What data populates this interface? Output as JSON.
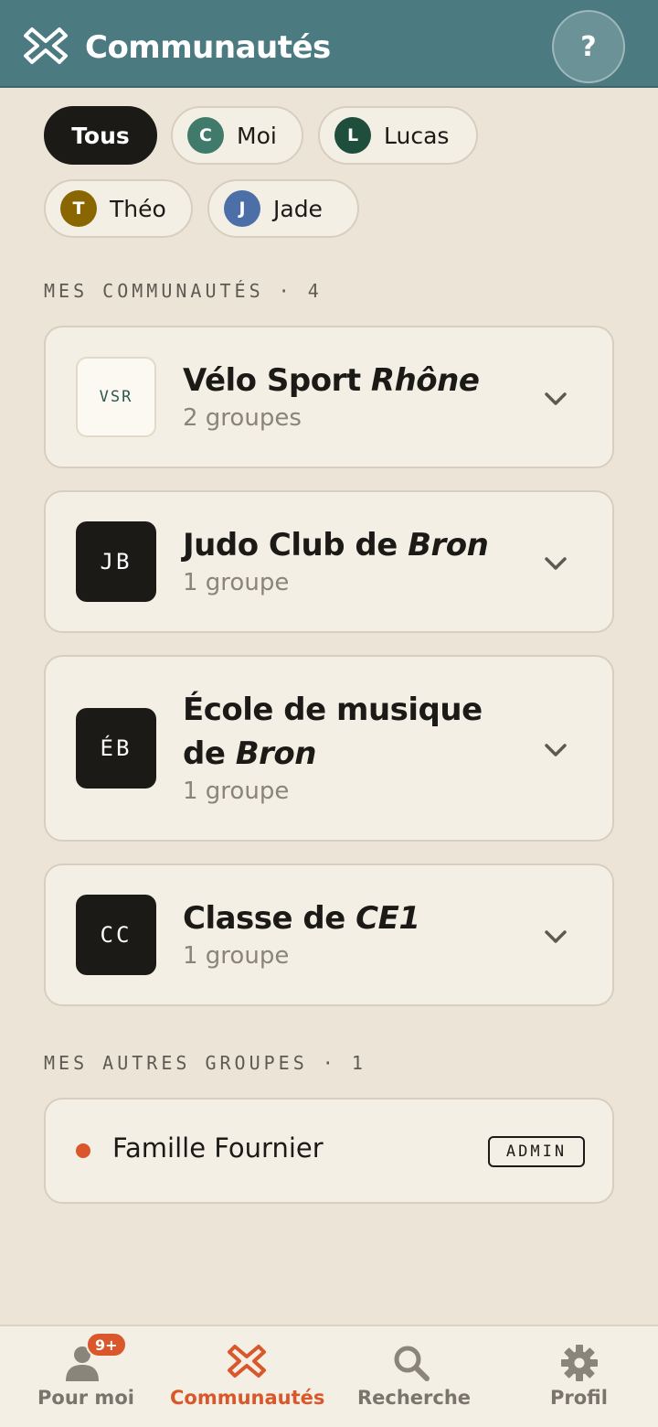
{
  "header": {
    "title": "Communautés",
    "help_label": "?"
  },
  "filters": {
    "all_label": "Tous",
    "members": [
      {
        "initial": "C",
        "name": "Moi",
        "color": "#3f7a6a"
      },
      {
        "initial": "L",
        "name": "Lucas",
        "color": "#1f4e3d"
      },
      {
        "initial": "T",
        "name": "Théo",
        "color": "#8a6600"
      },
      {
        "initial": "J",
        "name": "Jade",
        "color": "#4d6fa8"
      }
    ]
  },
  "communities": {
    "label": "MES COMMUNAUTÉS · 4",
    "items": [
      {
        "badge": "VSR",
        "title_plain": "Vélo Sport ",
        "title_em": "Rhône",
        "subtitle": "2 groupes"
      },
      {
        "badge": "JB",
        "title_plain": "Judo Club de ",
        "title_em": "Bron",
        "subtitle": "1 groupe"
      },
      {
        "badge": "ÉB",
        "title_plain": "École de musique de ",
        "title_em": "Bron",
        "subtitle": "1 groupe"
      },
      {
        "badge": "CC",
        "title_plain": "Classe de ",
        "title_em": "CE1",
        "subtitle": "1 groupe"
      }
    ]
  },
  "other_groups": {
    "label": "MES AUTRES GROUPES · 1",
    "items": [
      {
        "name": "Famille Fournier",
        "role": "ADMIN"
      }
    ]
  },
  "nav": {
    "items": [
      {
        "label": "Pour moi",
        "icon": "user-icon",
        "badge": "9+"
      },
      {
        "label": "Communautés",
        "icon": "communities-icon",
        "active": true
      },
      {
        "label": "Recherche",
        "icon": "search-icon"
      },
      {
        "label": "Profil",
        "icon": "gear-icon"
      }
    ]
  },
  "colors": {
    "header": "#4b7a80",
    "accent": "#d9572b",
    "background": "#ece4d7",
    "card": "#f4efe4"
  }
}
